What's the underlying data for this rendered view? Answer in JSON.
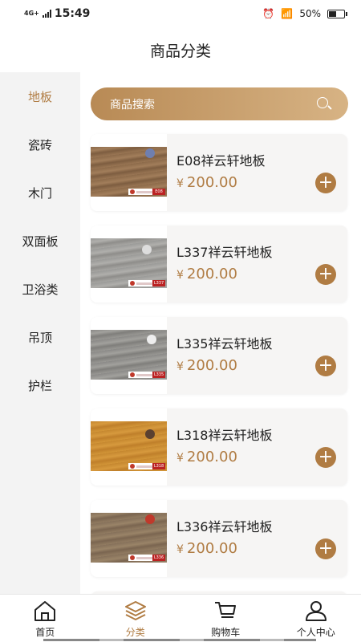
{
  "status_bar": {
    "network": "4G+",
    "time": "15:49",
    "battery": "50%",
    "battery_level": 0.5
  },
  "header": {
    "title": "商品分类"
  },
  "search": {
    "placeholder": "商品搜索"
  },
  "categories": [
    {
      "label": "地板",
      "active": true
    },
    {
      "label": "瓷砖",
      "active": false
    },
    {
      "label": "木门",
      "active": false
    },
    {
      "label": "双面板",
      "active": false
    },
    {
      "label": "卫浴类",
      "active": false
    },
    {
      "label": "吊顶",
      "active": false
    },
    {
      "label": "护栏",
      "active": false
    }
  ],
  "currency_symbol": "¥",
  "products": [
    {
      "name": "E08祥云轩地板",
      "price": "200.00",
      "code": "E08"
    },
    {
      "name": "L337祥云轩地板",
      "price": "200.00",
      "code": "L337"
    },
    {
      "name": "L335祥云轩地板",
      "price": "200.00",
      "code": "L335"
    },
    {
      "name": "L318祥云轩地板",
      "price": "200.00",
      "code": "L318"
    },
    {
      "name": "L336祥云轩地板",
      "price": "200.00",
      "code": "L336"
    }
  ],
  "tabbar": [
    {
      "label": "首页",
      "icon": "home-icon",
      "active": false
    },
    {
      "label": "分类",
      "icon": "category-icon",
      "active": true
    },
    {
      "label": "购物车",
      "icon": "cart-icon",
      "active": false
    },
    {
      "label": "个人中心",
      "icon": "user-icon",
      "active": false
    }
  ],
  "colors": {
    "accent": "#b07c43",
    "search_start": "#b88a55",
    "search_end": "#d7b384"
  }
}
